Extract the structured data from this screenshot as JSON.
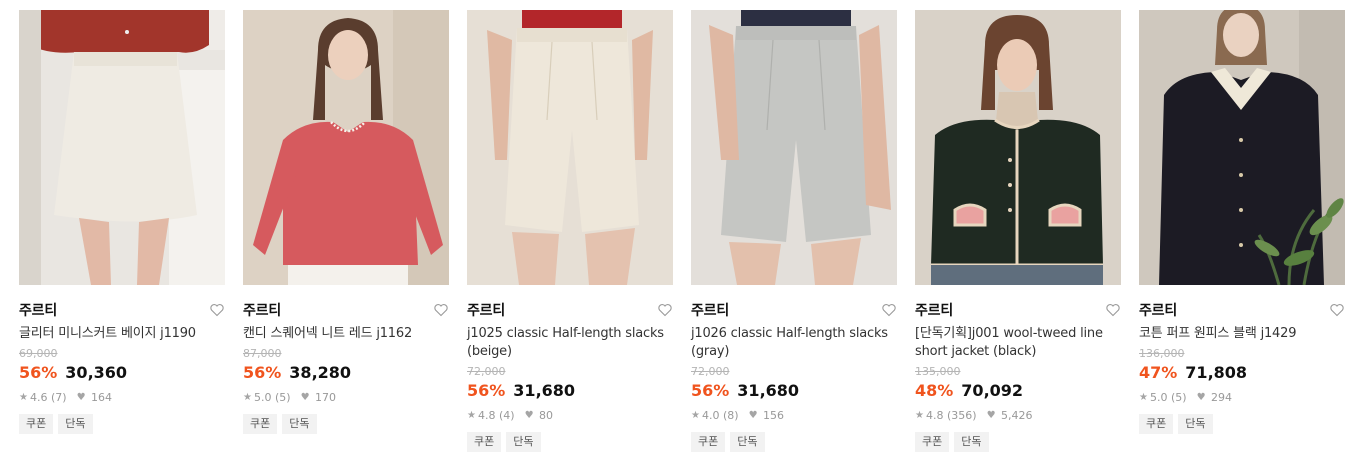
{
  "products": [
    {
      "brand": "주르티",
      "name": "글리터 미니스커트 베이지 j1190",
      "original_price": "69,000",
      "discount": "56%",
      "price": "30,360",
      "rating": "4.6",
      "reviews": "(7)",
      "likes": "164",
      "tags": [
        "쿠폰",
        "단독"
      ]
    },
    {
      "brand": "주르티",
      "name": "캔디 스퀘어넥 니트 레드 j1162",
      "original_price": "87,000",
      "discount": "56%",
      "price": "38,280",
      "rating": "5.0",
      "reviews": "(5)",
      "likes": "170",
      "tags": [
        "쿠폰",
        "단독"
      ]
    },
    {
      "brand": "주르티",
      "name": "j1025 classic Half-length slacks (beige)",
      "original_price": "72,000",
      "discount": "56%",
      "price": "31,680",
      "rating": "4.8",
      "reviews": "(4)",
      "likes": "80",
      "tags": [
        "쿠폰",
        "단독"
      ]
    },
    {
      "brand": "주르티",
      "name": "j1026 classic Half-length slacks (gray)",
      "original_price": "72,000",
      "discount": "56%",
      "price": "31,680",
      "rating": "4.0",
      "reviews": "(8)",
      "likes": "156",
      "tags": [
        "쿠폰",
        "단독"
      ]
    },
    {
      "brand": "주르티",
      "name": "[단독기획]j001 wool-tweed line short jacket (black)",
      "original_price": "135,000",
      "discount": "48%",
      "price": "70,092",
      "rating": "4.8",
      "reviews": "(356)",
      "likes": "5,426",
      "tags": [
        "쿠폰",
        "단독"
      ]
    },
    {
      "brand": "주르티",
      "name": "코튼 퍼프 원피스 블랙 j1429",
      "original_price": "136,000",
      "discount": "47%",
      "price": "71,808",
      "rating": "5.0",
      "reviews": "(5)",
      "likes": "294",
      "tags": [
        "쿠폰",
        "단독"
      ]
    }
  ],
  "icons": {
    "rating": "star-icon",
    "likes": "heart-icon",
    "wishlist": "heart-outline-icon"
  },
  "colors": {
    "discount": "#f0541e",
    "strikethrough": "#b5b5b5",
    "tag_bg": "#f2f2f2"
  }
}
